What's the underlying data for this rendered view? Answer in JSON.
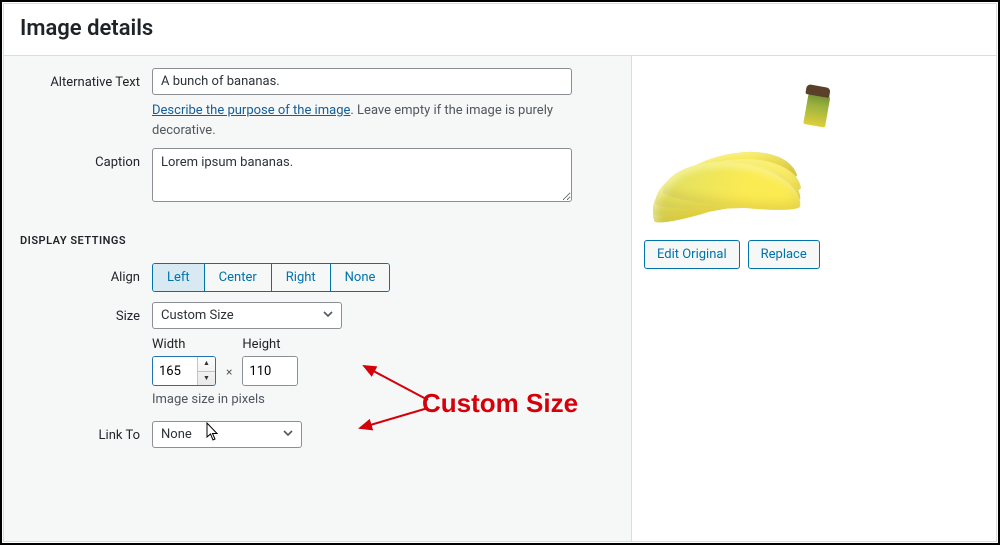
{
  "dialog": {
    "title": "Image details"
  },
  "fields": {
    "alt_label": "Alternative Text",
    "alt_value": "A bunch of bananas.",
    "alt_help_link": "Describe the purpose of the image",
    "alt_help_tail": ". Leave empty if the image is purely decorative.",
    "caption_label": "Caption",
    "caption_value": "Lorem ipsum bananas."
  },
  "display": {
    "heading": "DISPLAY SETTINGS",
    "align_label": "Align",
    "align_options": {
      "left": "Left",
      "center": "Center",
      "right": "Right",
      "none": "None"
    },
    "size_label": "Size",
    "size_value": "Custom Size",
    "width_label": "Width",
    "height_label": "Height",
    "width_value": "165",
    "height_value": "110",
    "times": "×",
    "pixels_note": "Image size in pixels",
    "linkto_label": "Link To",
    "linkto_value": "None"
  },
  "preview": {
    "edit_label": "Edit Original",
    "replace_label": "Replace"
  },
  "annotation": {
    "label": "Custom Size"
  }
}
